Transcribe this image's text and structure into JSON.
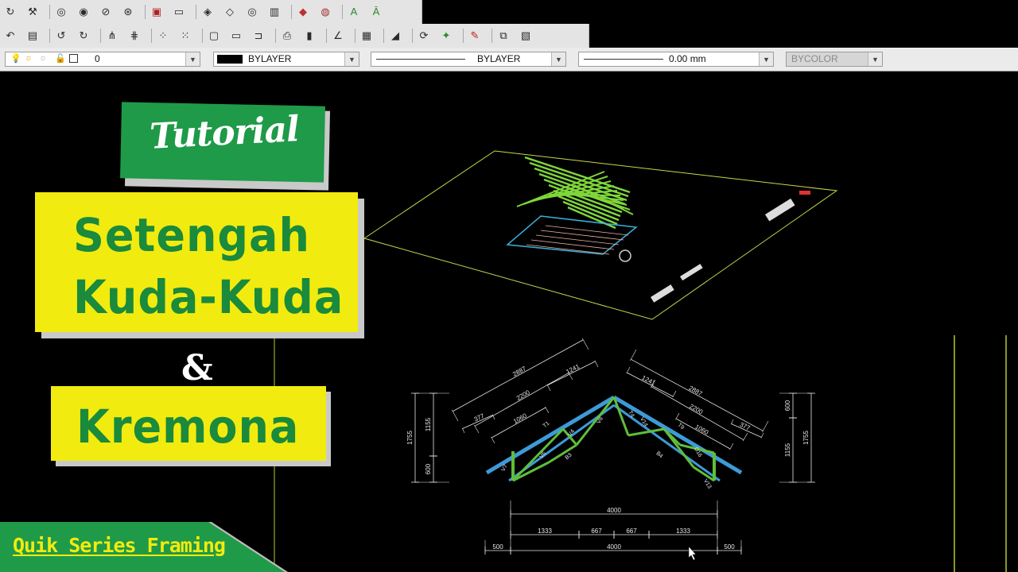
{
  "toolbar_row1": {
    "icons": [
      "rotate-arrow-icon",
      "wrench-icon",
      "orbit-icon",
      "continuous-orbit-icon",
      "free-orbit-icon",
      "orbit-settings-icon",
      "zoom-window-icon",
      "box-icon",
      "wedge-icon",
      "cone-icon",
      "sphere-icon",
      "cylinder-icon",
      "region-icon",
      "union-icon",
      "text-a-icon",
      "text-style-icon"
    ]
  },
  "toolbar_row2": {
    "icons": [
      "undo-icon",
      "layer-box-icon",
      "rotate-ccw-icon",
      "rotate-cw-icon",
      "mirror-icon",
      "mirror-3d-icon",
      "array-icon",
      "array-grid-icon",
      "viewport-icon",
      "rectangle-icon",
      "move-icon",
      "print-icon",
      "bar-chart-icon",
      "angle-icon",
      "grid-icon",
      "line-shade-icon",
      "eye-refresh-icon",
      "render-icon",
      "pencil-icon",
      "viewport-add-icon",
      "settings-folder-icon"
    ]
  },
  "properties_bar": {
    "layer": {
      "value": "0"
    },
    "color": {
      "value": "BYLAYER"
    },
    "linetype": {
      "value": "BYLAYER"
    },
    "lineweight": {
      "value": "0.00 mm"
    },
    "plotstyle": {
      "value": "BYCOLOR"
    }
  },
  "overlay": {
    "badge": "Tutorial",
    "title_line1": "Setengah",
    "title_line2": "Kuda-Kuda",
    "ampersand": "&",
    "title_line3": "Kremona",
    "footer": "Quik Series Framing"
  },
  "drawing": {
    "dims_left_rafter": [
      "2887",
      "2200",
      "1241",
      "1060",
      "377"
    ],
    "dims_right_rafter": [
      "2887",
      "2200",
      "1241",
      "1060",
      "377"
    ],
    "dims_left_vertical": [
      "1755",
      "1155",
      "600"
    ],
    "dims_right_vertical": [
      "1755",
      "1155",
      "600"
    ],
    "dims_bottom_total": "4000",
    "dims_bottom_segments": [
      "1333",
      "667",
      "667",
      "1333"
    ],
    "dims_overall": [
      "500",
      "4000",
      "500"
    ],
    "member_labels": [
      "V7",
      "V6",
      "T1",
      "V4",
      "B3",
      "V8",
      "T4",
      "V14",
      "T9",
      "D16",
      "B4",
      "V13"
    ],
    "colors": {
      "plan_outline": "#c8d84a",
      "hatch": "#7fd63b",
      "truss_members": "#5fbf3a",
      "rafter": "#3d9ad8",
      "dimension": "#e8e8e8",
      "grid_lines": "#b8c830"
    }
  }
}
